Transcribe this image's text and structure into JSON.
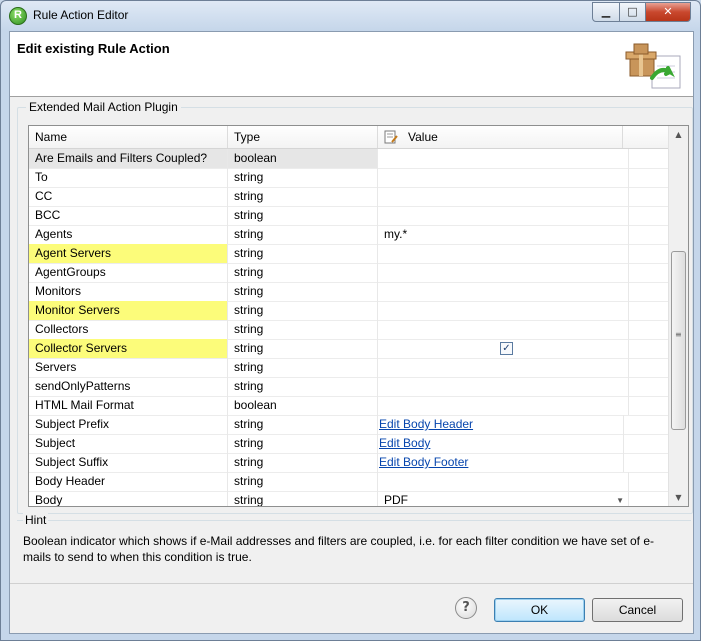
{
  "window": {
    "title": "Rule Action Editor",
    "min": "▁",
    "max": "□",
    "close": "✕"
  },
  "header": {
    "title": "Edit existing Rule Action"
  },
  "group": {
    "label": "Extended Mail Action Plugin"
  },
  "table": {
    "columns": {
      "name": "Name",
      "type": "Type",
      "value": "Value"
    },
    "rows": [
      {
        "name": "Are Emails and Filters Coupled?",
        "type": "boolean",
        "value": "",
        "highlight": false,
        "selected": true
      },
      {
        "name": "To",
        "type": "string",
        "value": ""
      },
      {
        "name": "CC",
        "type": "string",
        "value": ""
      },
      {
        "name": "BCC",
        "type": "string",
        "value": ""
      },
      {
        "name": "Agents",
        "type": "string",
        "value": "my.*"
      },
      {
        "name": "Agent Servers",
        "type": "string",
        "value": "",
        "highlight": true
      },
      {
        "name": "AgentGroups",
        "type": "string",
        "value": ""
      },
      {
        "name": "Monitors",
        "type": "string",
        "value": ""
      },
      {
        "name": "Monitor Servers",
        "type": "string",
        "value": "",
        "highlight": true
      },
      {
        "name": "Collectors",
        "type": "string",
        "value": ""
      },
      {
        "name": "Collector Servers",
        "type": "string",
        "value": "",
        "highlight": true,
        "checkbox": true
      },
      {
        "name": "Servers",
        "type": "string",
        "value": ""
      },
      {
        "name": "sendOnlyPatterns",
        "type": "string",
        "value": ""
      },
      {
        "name": "HTML Mail Format",
        "type": "boolean",
        "value": ""
      },
      {
        "name": "Subject Prefix",
        "type": "string",
        "value": "Edit Body Header",
        "link": true
      },
      {
        "name": "Subject",
        "type": "string",
        "value": "Edit Body",
        "link": true
      },
      {
        "name": "Subject Suffix",
        "type": "string",
        "value": "Edit Body Footer",
        "link": true
      },
      {
        "name": "Body Header",
        "type": "string",
        "value": ""
      },
      {
        "name": "Body",
        "type": "string",
        "value": "PDF",
        "dropdown": true
      }
    ]
  },
  "hint": {
    "label": "Hint",
    "text": "Boolean indicator which shows if e-Mail addresses and filters are coupled, i.e. for each filter condition we have set of e-mails to send to when this condition is true."
  },
  "buttons": {
    "help": "?",
    "ok": "OK",
    "cancel": "Cancel"
  }
}
